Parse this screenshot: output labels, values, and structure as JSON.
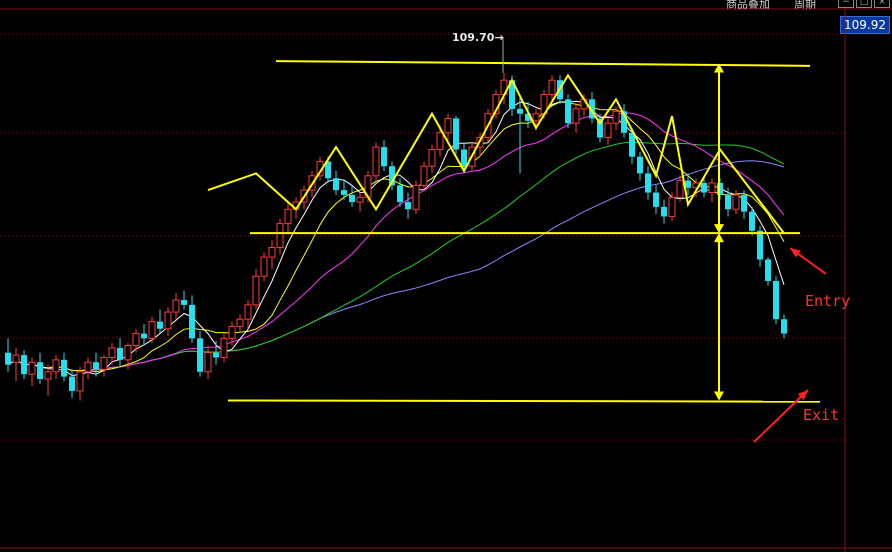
{
  "toolbar": {
    "menu_a": "商品叠加",
    "menu_b": "周期",
    "icon_minimize": "minimize-icon",
    "icon_restore": "restore-icon",
    "icon_close": "close-icon"
  },
  "price_tag": "109.92",
  "peak_label": "109.70",
  "annotations": {
    "entry": "Entry",
    "exit": "Exit"
  },
  "colors": {
    "up": "#ff3a3a",
    "down": "#22e0f0",
    "pattern": "#ffff00",
    "entry_arrow": "#ff2020",
    "ma5": "#ffffff",
    "ma10": "#ffff00",
    "ma20": "#ff33ff",
    "ma40": "#22cc22",
    "ma60": "#8888ff"
  },
  "chart_data": {
    "type": "candlestick",
    "title": "",
    "last_price": 109.92,
    "marked_high": 109.7,
    "candles": [
      {
        "o": 98.0,
        "h": 98.6,
        "l": 97.2,
        "c": 97.5
      },
      {
        "o": 97.6,
        "h": 98.2,
        "l": 96.8,
        "c": 97.9
      },
      {
        "o": 97.9,
        "h": 98.1,
        "l": 96.9,
        "c": 97.1
      },
      {
        "o": 97.1,
        "h": 97.8,
        "l": 96.6,
        "c": 97.6
      },
      {
        "o": 97.6,
        "h": 98.0,
        "l": 96.7,
        "c": 96.9
      },
      {
        "o": 96.9,
        "h": 97.5,
        "l": 96.2,
        "c": 97.2
      },
      {
        "o": 97.2,
        "h": 97.9,
        "l": 96.9,
        "c": 97.7
      },
      {
        "o": 97.7,
        "h": 98.0,
        "l": 96.8,
        "c": 97.0
      },
      {
        "o": 97.0,
        "h": 97.3,
        "l": 96.1,
        "c": 96.4
      },
      {
        "o": 96.4,
        "h": 97.4,
        "l": 96.0,
        "c": 97.2
      },
      {
        "o": 97.2,
        "h": 97.8,
        "l": 96.9,
        "c": 97.6
      },
      {
        "o": 97.6,
        "h": 98.0,
        "l": 97.0,
        "c": 97.3
      },
      {
        "o": 97.3,
        "h": 97.9,
        "l": 97.0,
        "c": 97.8
      },
      {
        "o": 97.8,
        "h": 98.4,
        "l": 97.5,
        "c": 98.2
      },
      {
        "o": 98.2,
        "h": 98.6,
        "l": 97.4,
        "c": 97.7
      },
      {
        "o": 97.7,
        "h": 98.4,
        "l": 97.3,
        "c": 98.3
      },
      {
        "o": 98.3,
        "h": 99.0,
        "l": 98.0,
        "c": 98.8
      },
      {
        "o": 98.8,
        "h": 99.2,
        "l": 98.3,
        "c": 98.6
      },
      {
        "o": 98.6,
        "h": 99.5,
        "l": 98.4,
        "c": 99.3
      },
      {
        "o": 99.3,
        "h": 99.8,
        "l": 98.8,
        "c": 99.0
      },
      {
        "o": 99.0,
        "h": 99.9,
        "l": 98.7,
        "c": 99.7
      },
      {
        "o": 99.7,
        "h": 100.5,
        "l": 99.4,
        "c": 100.2
      },
      {
        "o": 100.2,
        "h": 100.6,
        "l": 99.8,
        "c": 100.0
      },
      {
        "o": 100.0,
        "h": 100.4,
        "l": 98.4,
        "c": 98.6
      },
      {
        "o": 98.6,
        "h": 98.9,
        "l": 97.0,
        "c": 97.2
      },
      {
        "o": 97.2,
        "h": 98.3,
        "l": 96.9,
        "c": 98.0
      },
      {
        "o": 98.0,
        "h": 98.5,
        "l": 97.5,
        "c": 97.8
      },
      {
        "o": 97.8,
        "h": 98.8,
        "l": 97.6,
        "c": 98.6
      },
      {
        "o": 98.6,
        "h": 99.3,
        "l": 98.3,
        "c": 99.1
      },
      {
        "o": 99.1,
        "h": 99.6,
        "l": 98.9,
        "c": 99.4
      },
      {
        "o": 99.4,
        "h": 100.2,
        "l": 99.0,
        "c": 100.0
      },
      {
        "o": 100.0,
        "h": 101.5,
        "l": 99.8,
        "c": 101.2
      },
      {
        "o": 101.2,
        "h": 102.2,
        "l": 101.0,
        "c": 102.0
      },
      {
        "o": 102.0,
        "h": 102.7,
        "l": 101.5,
        "c": 102.4
      },
      {
        "o": 102.4,
        "h": 103.6,
        "l": 102.1,
        "c": 103.4
      },
      {
        "o": 103.4,
        "h": 104.3,
        "l": 103.0,
        "c": 104.0
      },
      {
        "o": 104.0,
        "h": 104.5,
        "l": 103.6,
        "c": 104.3
      },
      {
        "o": 104.3,
        "h": 105.0,
        "l": 104.0,
        "c": 104.8
      },
      {
        "o": 104.8,
        "h": 105.6,
        "l": 104.5,
        "c": 105.4
      },
      {
        "o": 105.4,
        "h": 106.2,
        "l": 105.2,
        "c": 106.0
      },
      {
        "o": 106.0,
        "h": 106.2,
        "l": 105.1,
        "c": 105.3
      },
      {
        "o": 105.3,
        "h": 105.6,
        "l": 104.6,
        "c": 104.8
      },
      {
        "o": 104.8,
        "h": 105.2,
        "l": 104.4,
        "c": 104.6
      },
      {
        "o": 104.6,
        "h": 105.0,
        "l": 104.1,
        "c": 104.3
      },
      {
        "o": 104.3,
        "h": 104.7,
        "l": 103.9,
        "c": 104.5
      },
      {
        "o": 104.5,
        "h": 105.6,
        "l": 104.3,
        "c": 105.4
      },
      {
        "o": 105.4,
        "h": 106.8,
        "l": 105.2,
        "c": 106.6
      },
      {
        "o": 106.6,
        "h": 106.9,
        "l": 105.6,
        "c": 105.8
      },
      {
        "o": 105.8,
        "h": 106.0,
        "l": 104.8,
        "c": 105.0
      },
      {
        "o": 105.0,
        "h": 105.3,
        "l": 104.1,
        "c": 104.3
      },
      {
        "o": 104.3,
        "h": 104.7,
        "l": 103.6,
        "c": 104.0
      },
      {
        "o": 104.0,
        "h": 105.2,
        "l": 103.8,
        "c": 105.0
      },
      {
        "o": 105.0,
        "h": 106.0,
        "l": 104.8,
        "c": 105.8
      },
      {
        "o": 105.8,
        "h": 106.7,
        "l": 105.5,
        "c": 106.5
      },
      {
        "o": 106.5,
        "h": 107.5,
        "l": 106.2,
        "c": 107.2
      },
      {
        "o": 107.2,
        "h": 108.0,
        "l": 106.9,
        "c": 107.8
      },
      {
        "o": 107.8,
        "h": 107.9,
        "l": 106.3,
        "c": 106.5
      },
      {
        "o": 106.5,
        "h": 106.8,
        "l": 105.5,
        "c": 105.8
      },
      {
        "o": 105.8,
        "h": 106.8,
        "l": 105.6,
        "c": 106.6
      },
      {
        "o": 106.6,
        "h": 107.2,
        "l": 106.2,
        "c": 107.0
      },
      {
        "o": 107.0,
        "h": 108.2,
        "l": 106.8,
        "c": 108.0
      },
      {
        "o": 108.0,
        "h": 109.0,
        "l": 107.8,
        "c": 108.8
      },
      {
        "o": 108.8,
        "h": 109.7,
        "l": 108.4,
        "c": 109.4
      },
      {
        "o": 109.4,
        "h": 109.6,
        "l": 107.9,
        "c": 108.2
      },
      {
        "o": 108.2,
        "h": 108.8,
        "l": 105.5,
        "c": 108.0
      },
      {
        "o": 108.0,
        "h": 108.5,
        "l": 107.4,
        "c": 107.7
      },
      {
        "o": 107.7,
        "h": 108.2,
        "l": 107.3,
        "c": 108.0
      },
      {
        "o": 108.0,
        "h": 109.0,
        "l": 107.8,
        "c": 108.8
      },
      {
        "o": 108.8,
        "h": 109.6,
        "l": 108.6,
        "c": 109.4
      },
      {
        "o": 109.4,
        "h": 109.6,
        "l": 108.4,
        "c": 108.6
      },
      {
        "o": 108.6,
        "h": 108.8,
        "l": 107.4,
        "c": 107.6
      },
      {
        "o": 107.6,
        "h": 108.4,
        "l": 107.2,
        "c": 108.2
      },
      {
        "o": 108.2,
        "h": 108.8,
        "l": 107.9,
        "c": 108.6
      },
      {
        "o": 108.6,
        "h": 108.9,
        "l": 107.6,
        "c": 107.8
      },
      {
        "o": 107.8,
        "h": 108.0,
        "l": 106.8,
        "c": 107.0
      },
      {
        "o": 107.0,
        "h": 107.8,
        "l": 106.7,
        "c": 107.6
      },
      {
        "o": 107.6,
        "h": 108.3,
        "l": 107.3,
        "c": 108.1
      },
      {
        "o": 108.1,
        "h": 108.4,
        "l": 107.0,
        "c": 107.2
      },
      {
        "o": 107.2,
        "h": 107.4,
        "l": 105.9,
        "c": 106.2
      },
      {
        "o": 106.2,
        "h": 106.4,
        "l": 105.2,
        "c": 105.5
      },
      {
        "o": 105.5,
        "h": 105.8,
        "l": 104.4,
        "c": 104.7
      },
      {
        "o": 104.7,
        "h": 105.0,
        "l": 103.8,
        "c": 104.1
      },
      {
        "o": 104.1,
        "h": 104.4,
        "l": 103.4,
        "c": 103.7
      },
      {
        "o": 103.7,
        "h": 104.7,
        "l": 103.5,
        "c": 104.5
      },
      {
        "o": 104.5,
        "h": 105.4,
        "l": 104.3,
        "c": 105.2
      },
      {
        "o": 105.2,
        "h": 105.5,
        "l": 104.6,
        "c": 104.9
      },
      {
        "o": 104.9,
        "h": 105.3,
        "l": 104.5,
        "c": 105.1
      },
      {
        "o": 105.1,
        "h": 105.4,
        "l": 104.5,
        "c": 104.7
      },
      {
        "o": 104.7,
        "h": 105.3,
        "l": 104.3,
        "c": 105.1
      },
      {
        "o": 105.1,
        "h": 105.3,
        "l": 104.4,
        "c": 104.6
      },
      {
        "o": 104.6,
        "h": 104.9,
        "l": 103.7,
        "c": 104.0
      },
      {
        "o": 104.0,
        "h": 104.8,
        "l": 103.8,
        "c": 104.6
      },
      {
        "o": 104.6,
        "h": 104.8,
        "l": 103.6,
        "c": 103.9
      },
      {
        "o": 103.9,
        "h": 104.1,
        "l": 102.9,
        "c": 103.1
      },
      {
        "o": 103.1,
        "h": 103.3,
        "l": 101.6,
        "c": 101.9
      },
      {
        "o": 101.9,
        "h": 102.0,
        "l": 100.8,
        "c": 101.0
      },
      {
        "o": 101.0,
        "h": 101.2,
        "l": 99.2,
        "c": 99.4
      },
      {
        "o": 99.4,
        "h": 99.6,
        "l": 98.6,
        "c": 98.8
      }
    ],
    "pattern_zigzag": [
      [
        25,
        104.8
      ],
      [
        31,
        105.5
      ],
      [
        36,
        104.0
      ],
      [
        41,
        106.6
      ],
      [
        46,
        104.0
      ],
      [
        53,
        108.0
      ],
      [
        57,
        105.6
      ],
      [
        63,
        109.4
      ],
      [
        66,
        107.4
      ],
      [
        70,
        109.6
      ],
      [
        74,
        107.6
      ],
      [
        76,
        108.6
      ],
      [
        81,
        105.4
      ],
      [
        83,
        107.9
      ],
      [
        85,
        104.2
      ],
      [
        89,
        106.5
      ],
      [
        97,
        103.0
      ]
    ],
    "levels": {
      "resistance": 110.1,
      "neckline": 103.0,
      "target": 96.0
    },
    "ylim": [
      91.0,
      111.5
    ]
  }
}
